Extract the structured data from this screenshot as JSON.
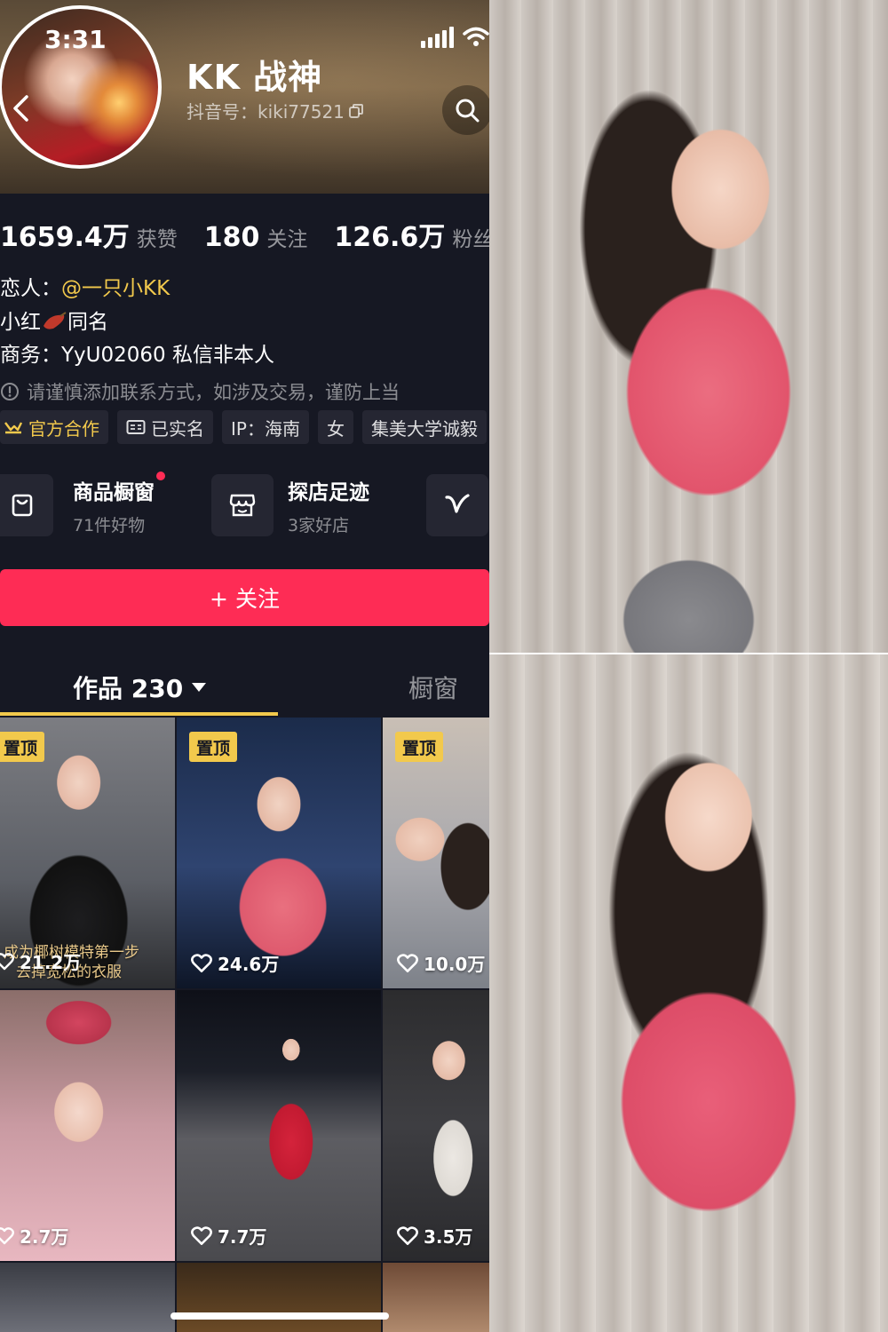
{
  "status_bar": {
    "time": "3:31"
  },
  "profile": {
    "nickname": "KK 战神",
    "douyin_id": "抖音号：kiki77521"
  },
  "stats": [
    {
      "value": "1659.4万",
      "label": "获赞"
    },
    {
      "value": "180",
      "label": "关注"
    },
    {
      "value": "126.6万",
      "label": "粉丝"
    }
  ],
  "bio": {
    "line1_prefix": "恋人：",
    "line1_mention": "@一只小KK",
    "line2_prefix": "小红",
    "line2_suffix": "同名",
    "line3": "商务：YyU02060 私信非本人",
    "warning": "请谨慎添加联系方式，如涉及交易，谨防上当"
  },
  "tags": [
    "官方合作",
    "已实名",
    "IP：海南",
    "女",
    "集美大学诚毅"
  ],
  "cards": [
    {
      "title": "商品橱窗",
      "sub": "71件好物"
    },
    {
      "title": "探店足迹",
      "sub": "3家好店"
    }
  ],
  "follow_button": "+ 关注",
  "tabs": {
    "works": "作品 230",
    "showcase": "橱窗"
  },
  "grid": [
    {
      "pinned": "置顶",
      "likes": "21.2万",
      "caption_1": "成为椰树模特第一步",
      "caption_2": "去掉宽松的衣服"
    },
    {
      "pinned": "置顶",
      "likes": "24.6万"
    },
    {
      "pinned": "置顶",
      "likes": "10.0万"
    },
    {
      "likes": "2.7万"
    },
    {
      "likes": "7.7万"
    },
    {
      "likes": "3.5万"
    }
  ],
  "colors": {
    "background": "#161823",
    "accent_red": "#fe2c55",
    "accent_gold": "#f2c94c"
  }
}
